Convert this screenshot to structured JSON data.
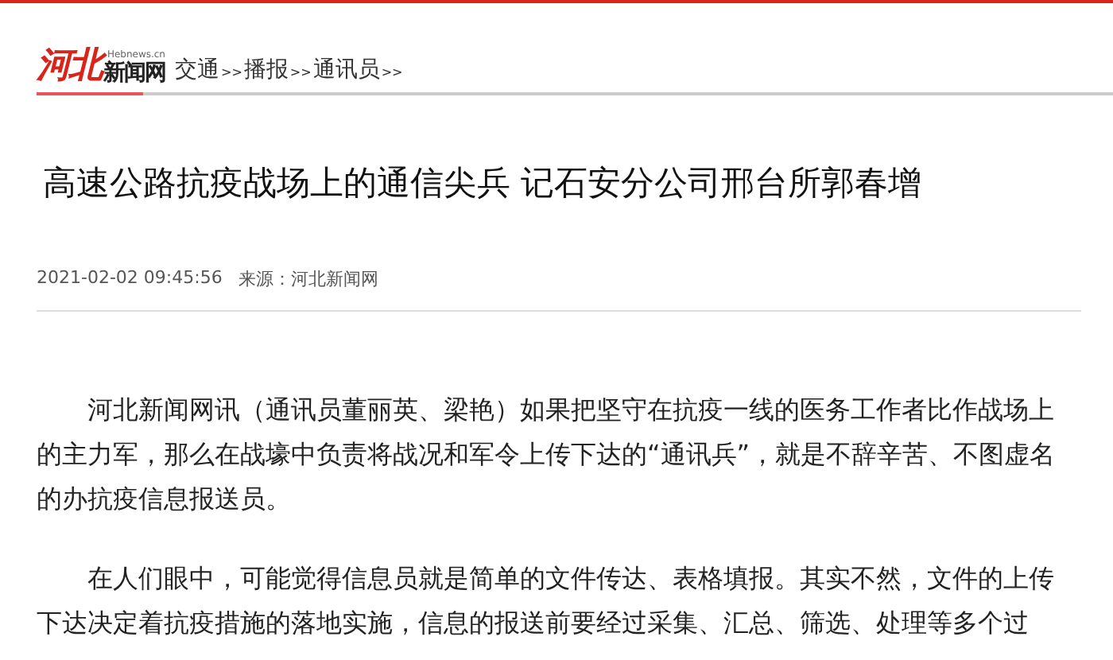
{
  "logo": {
    "mark": "河北",
    "domain": "Hebnews.cn",
    "name": "新闻网"
  },
  "breadcrumb": [
    {
      "label": "交通",
      "separator": ">>"
    },
    {
      "label": "播报",
      "separator": ">>"
    },
    {
      "label": "通讯员",
      "separator": ">>"
    }
  ],
  "article": {
    "title": "高速公路抗疫战场上的通信尖兵 记石安分公司邢台所郭春增",
    "date": "2021-02-02 09:45:56",
    "source": "来源：河北新闻网",
    "paragraphs": [
      "河北新闻网讯（通讯员董丽英、梁艳）如果把坚守在抗疫一线的医务工作者比作战场上的主力军，那么在战壕中负责将战况和军令上传下达的“通讯兵”，就是不辞辛苦、不图虚名的办抗疫信息报送员。",
      "在人们眼中，可能觉得信息员就是简单的文件传达、表格填报。其实不然，文件的上传下达决定着抗疫措施的落地实施，信息的报送前要经过采集、汇总、筛选、处理等多个过"
    ]
  }
}
